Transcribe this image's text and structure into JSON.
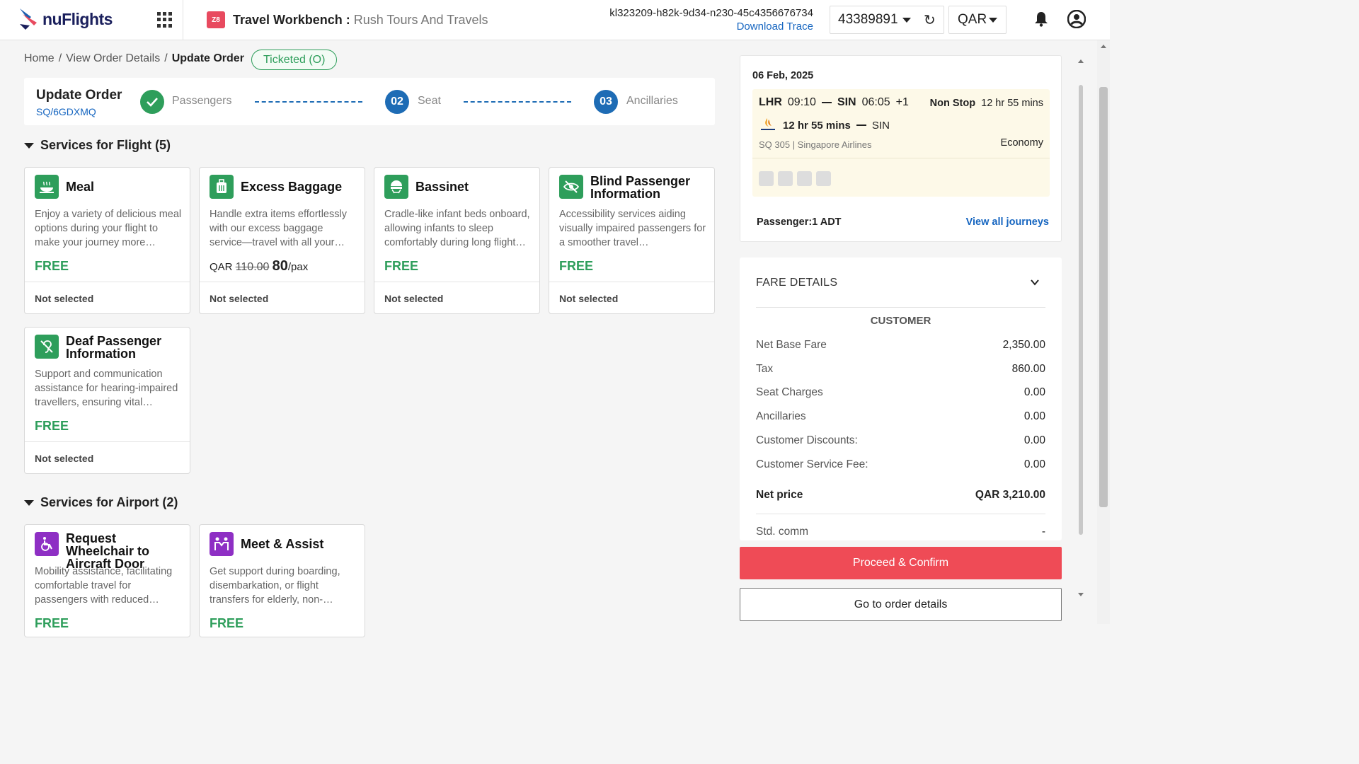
{
  "header": {
    "brand": "nuFlights",
    "workbench_title": "Travel Workbench :",
    "agency": "Rush Tours And Travels",
    "trace_id": "kl323209-h82k-9d34-n230-45c4356676734",
    "download_trace": "Download Trace",
    "account": "43389891",
    "currency": "QAR",
    "workbench_icon_text": "Z8",
    "colors": {
      "brand": "#1a1f5c",
      "accent": "#e84a5f"
    }
  },
  "breadcrumb": {
    "home": "Home",
    "sep": "/",
    "view": "View Order Details",
    "current": "Update Order"
  },
  "status": "Ticketed (O)",
  "stepper": {
    "title": "Update Order",
    "pnr": "SQ/6GDXMQ",
    "steps": [
      {
        "num": "",
        "label": "Passengers",
        "state": "done"
      },
      {
        "num": "02",
        "label": "Seat",
        "state": "pending"
      },
      {
        "num": "03",
        "label": "Ancillaries",
        "state": "pending"
      }
    ]
  },
  "sections": {
    "flight": "Services for Flight (5)",
    "airport": "Services for Airport (2)"
  },
  "cards": [
    {
      "title": "Meal",
      "desc": "Enjoy a variety of delicious meal options during your flight to make your journey more…",
      "price": "FREE",
      "foot": "Not selected",
      "icon": "meal-icon"
    },
    {
      "title": "Excess Baggage",
      "desc": "Handle extra items effortlessly with our excess baggage service—travel with all your…",
      "cur": "QAR",
      "old": "110.00",
      "new": "80",
      "unit": "/pax",
      "foot": "Not selected",
      "icon": "baggage-icon"
    },
    {
      "title": "Bassinet",
      "desc": "Cradle-like infant beds onboard, allowing infants to sleep comfortably during long flight…",
      "price": "FREE",
      "foot": "Not selected",
      "icon": "bassinet-icon"
    },
    {
      "title": "Blind Passenger Information",
      "desc": "Accessibility services aiding visually impaired passengers for a smoother travel…",
      "price": "FREE",
      "foot": "Not selected",
      "icon": "eye-off-icon"
    },
    {
      "title": "Deaf Passenger Information",
      "desc": "Support and communication assistance for hearing-impaired travellers, ensuring vital…",
      "price": "FREE",
      "foot": "Not selected",
      "icon": "ear-off-icon"
    },
    {
      "title": "Request Wheelchair to Aircraft Door",
      "desc": "Mobility assistance, facilitating comfortable travel for passengers with reduced…",
      "price": "FREE",
      "icon": "wheelchair-icon"
    },
    {
      "title": "Meet & Assist",
      "desc": "Get support during boarding, disembarkation, or flight transfers for elderly, non-…",
      "price": "FREE",
      "icon": "meet-assist-icon"
    }
  ],
  "journey": {
    "date": "06 Feb, 2025",
    "from": "LHR",
    "dep": "09:10",
    "to": "SIN",
    "arr": "06:05",
    "day_offset": "+1",
    "stops": "Non Stop",
    "duration": "12 hr 55 mins",
    "duration2": "12 hr 55 mins",
    "dest2": "SIN",
    "flight_no": "SQ 305 | Singapore Airlines",
    "cabin": "Economy",
    "passenger": "Passenger:1 ADT",
    "view_all": "View all journeys"
  },
  "fare": {
    "title": "FARE DETAILS",
    "customer": "CUSTOMER",
    "rows": [
      {
        "label": "Net Base Fare",
        "value": "2,350.00"
      },
      {
        "label": "Tax",
        "value": "860.00"
      },
      {
        "label": "Seat Charges",
        "value": "0.00"
      },
      {
        "label": "Ancillaries",
        "value": "0.00"
      },
      {
        "label": "Customer Discounts:",
        "value": "0.00"
      },
      {
        "label": "Customer Service Fee:",
        "value": "0.00"
      }
    ],
    "net_label": "Net price",
    "net_value": "QAR 3,210.00",
    "std_label": "Std. comm",
    "std_value": "-"
  },
  "buttons": {
    "proceed": "Proceed & Confirm",
    "order": "Go to order details"
  }
}
